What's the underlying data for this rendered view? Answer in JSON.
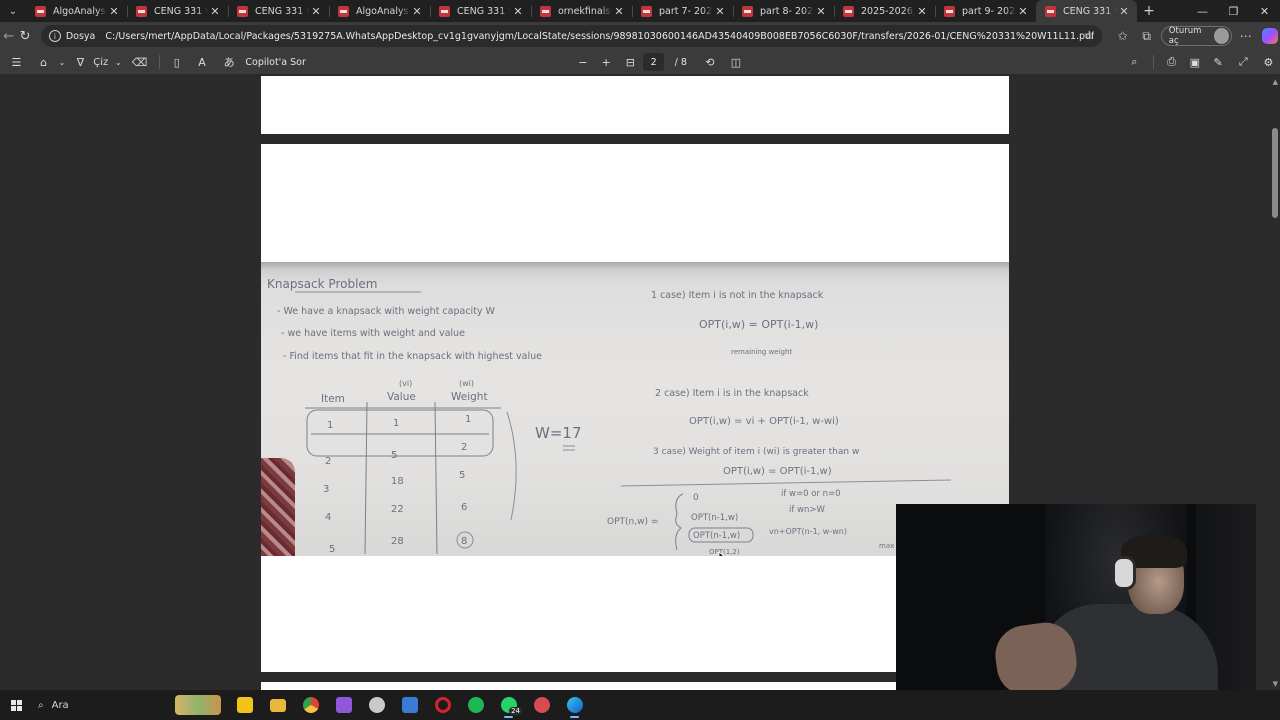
{
  "browser": {
    "tabs": [
      {
        "title": "AlgoAnalysis W3",
        "active": false
      },
      {
        "title": "CENG 331 W12L",
        "active": false
      },
      {
        "title": "CENG 331 W9L9",
        "active": false
      },
      {
        "title": "AlgoAnalysisW8L",
        "active": false
      },
      {
        "title": "CENG 331 W10L",
        "active": false
      },
      {
        "title": "ornekfinalsorular",
        "active": false
      },
      {
        "title": "part 7- 2025.pdf",
        "active": false
      },
      {
        "title": "part 8- 2025.pdf",
        "active": false
      },
      {
        "title": "2025-2026_Guz",
        "active": false
      },
      {
        "title": "part 9- 2025.pdf",
        "active": false
      },
      {
        "title": "CENG 331 W11L",
        "active": true
      }
    ],
    "address": {
      "scheme_label": "Dosya",
      "url": "C:/Users/mert/AppData/Local/Packages/5319275A.WhatsAppDesktop_cv1g1gvanyjgm/LocalState/sessions/98981030600146AD43540409B008EB7056C6030F/transfers/2026-01/CENG%20331%20W11L11.pdf"
    },
    "signin_label": "Oturum aç"
  },
  "pdf_toolbar": {
    "draw_label": "Çiz",
    "copilot_label": "Copilot'a Sor",
    "current_page": "2",
    "total_pages": "/ 8"
  },
  "whiteboard": {
    "title": "Knapsack Problem",
    "bullets": [
      "- We have a knapsack with weight capacity W",
      "- we have items with weight and value",
      "- Find items that fit in the knapsack with highest value"
    ],
    "table": {
      "headers": [
        "Item",
        "Value",
        "Weight"
      ],
      "header_sub": [
        "",
        "(vi)",
        "(wi)"
      ],
      "rows": [
        [
          "1",
          "1",
          "1"
        ],
        [
          "2",
          "5",
          "2"
        ],
        [
          "3",
          "18",
          "5"
        ],
        [
          "4",
          "22",
          "6"
        ],
        [
          "5",
          "28",
          "8"
        ]
      ]
    },
    "capacity": "W=17",
    "cases": [
      "1 case) Item i is not in the knapsack",
      "OPT(i,w) = OPT(i-1,w)",
      "remaining weight",
      "2 case) Item i is in the knapsack",
      "OPT(i,w) = vi + OPT(i-1, w-wi)",
      "3 case) Weight of item i (wi) is greater than w",
      "OPT(i,w) = OPT(i-1,w)"
    ],
    "recurrence": {
      "lhs": "OPT(n,w) =",
      "lines": [
        "0",
        "OPT(n-1,w)",
        "OPT(n-1,w)",
        "vn+OPT(n-1, w-wn)"
      ],
      "conditions": [
        "if  w=0  or  n=0",
        "if  wn>W",
        "max"
      ],
      "extra": "OPT(1,2)"
    }
  },
  "taskbar": {
    "search_label": "Ara",
    "whatsapp_badge": "24"
  }
}
